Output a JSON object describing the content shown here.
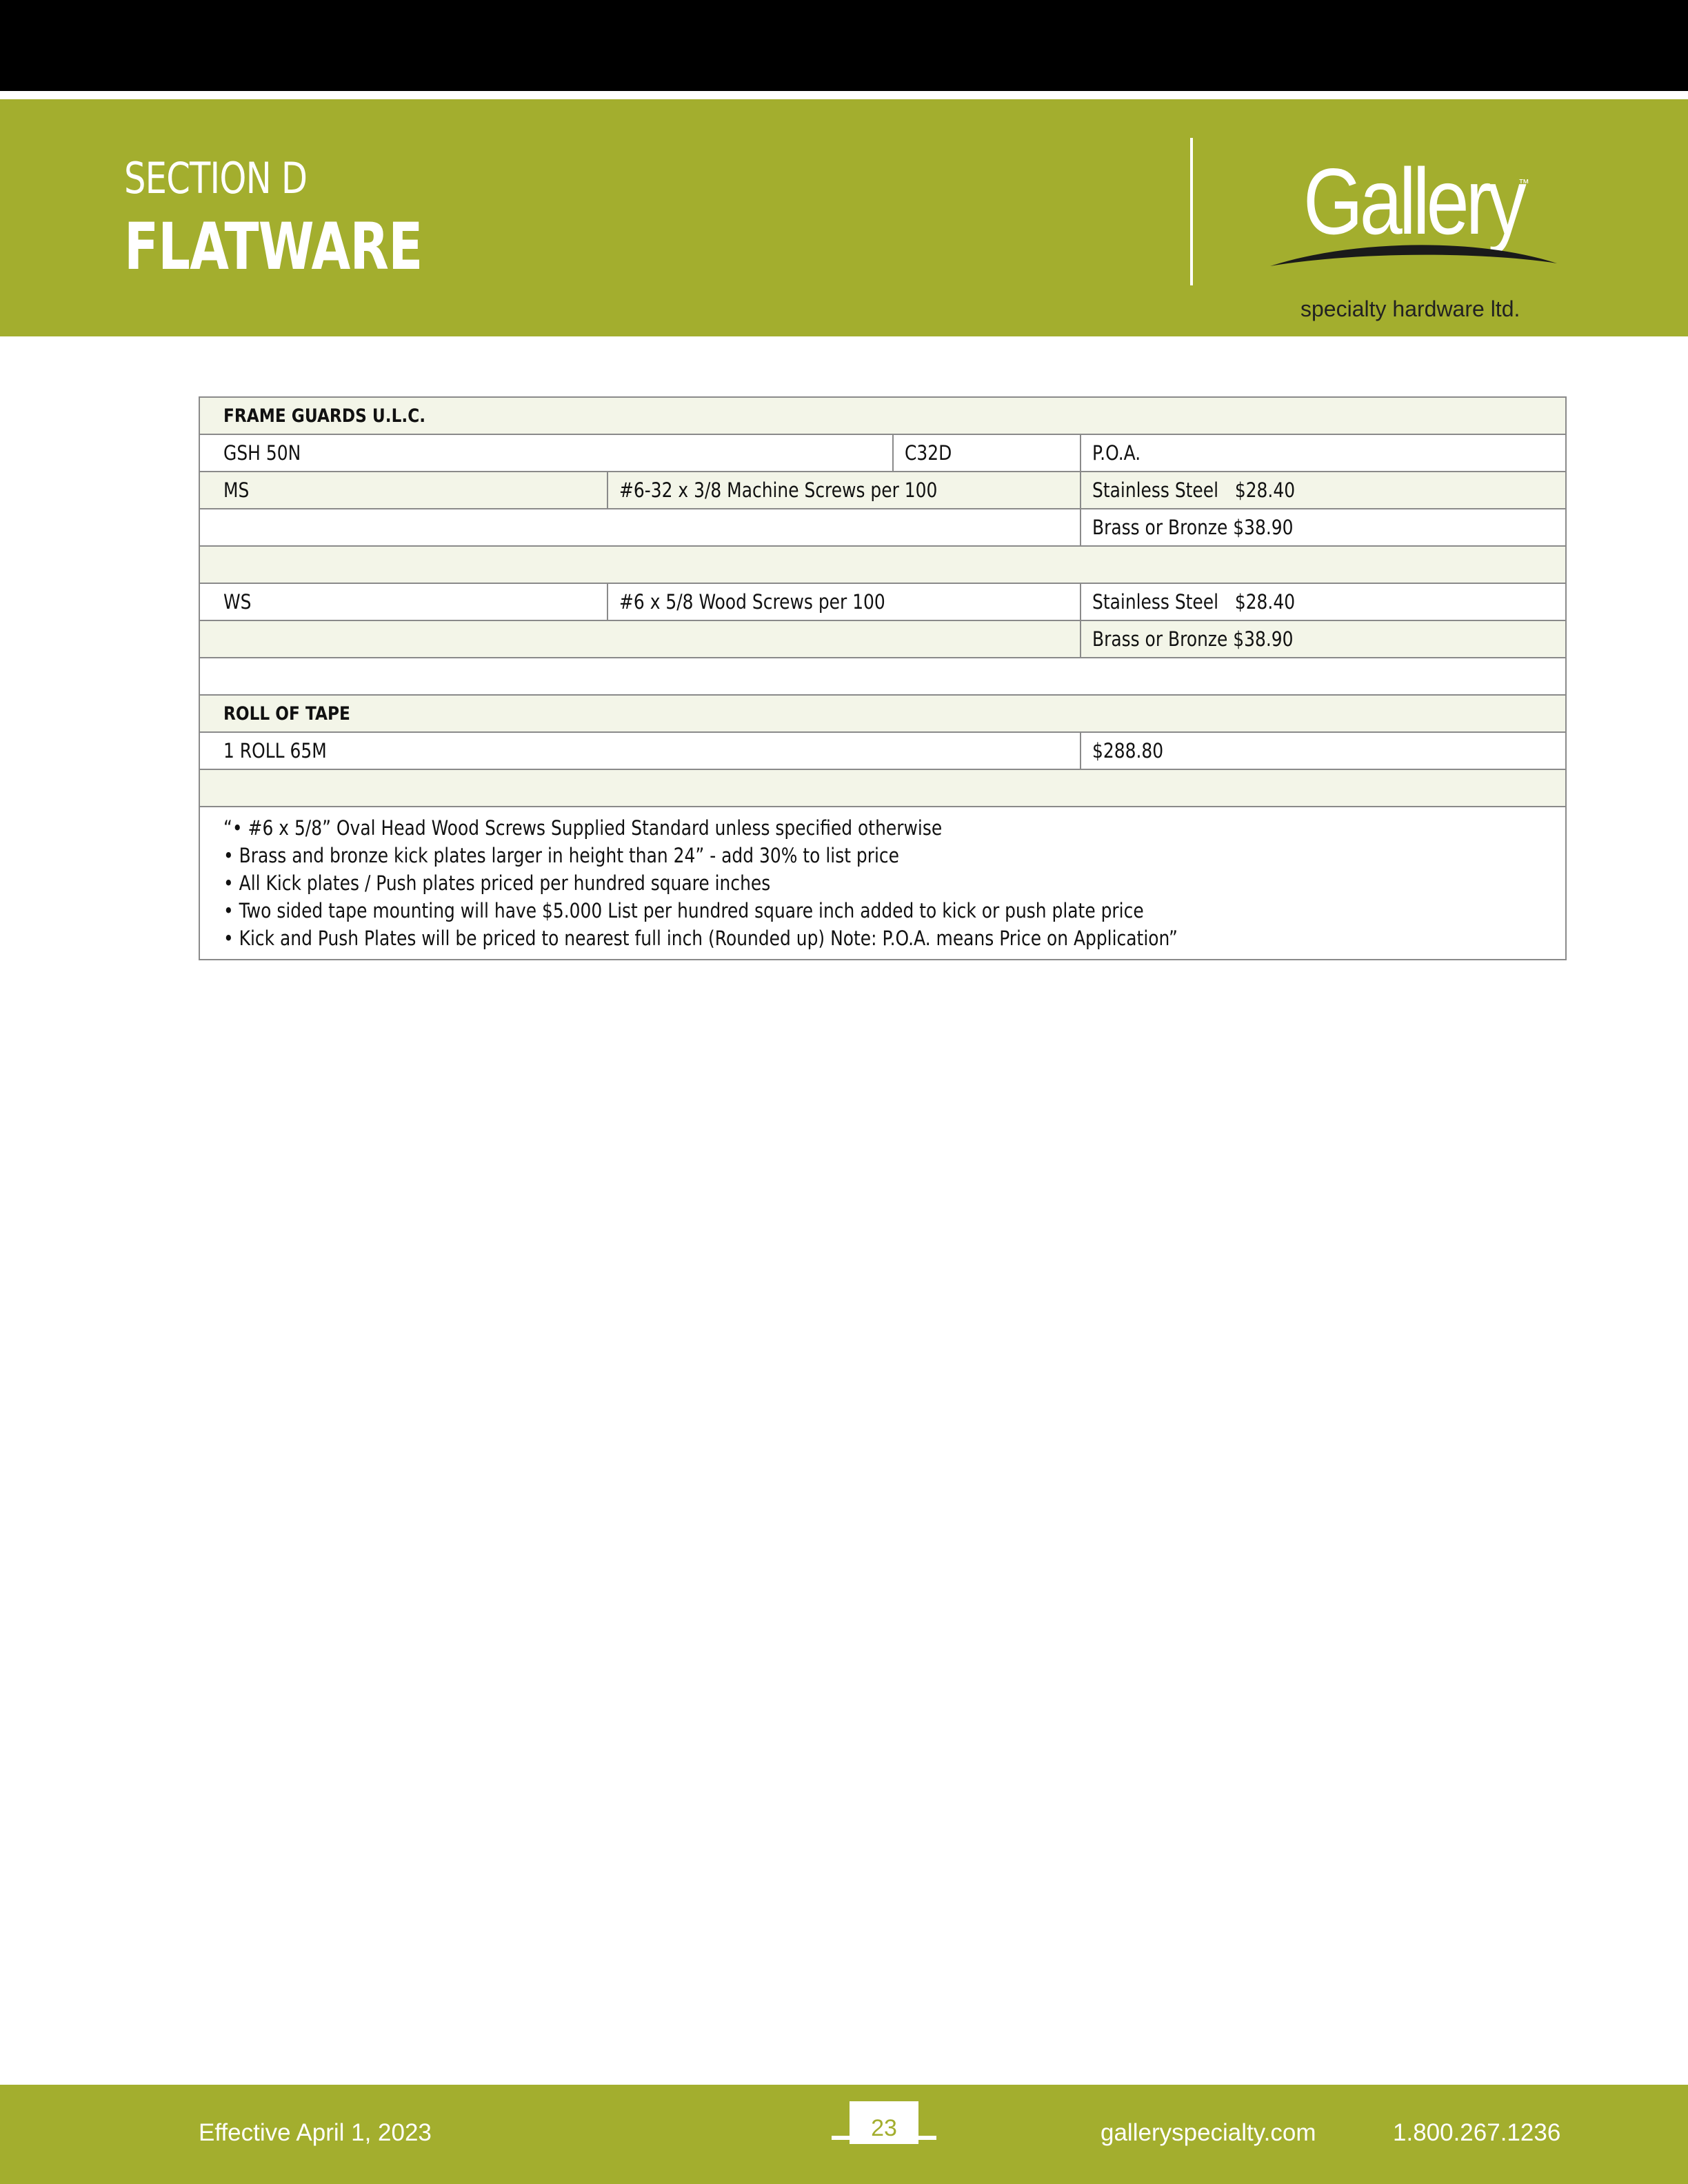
{
  "header": {
    "section_label": "SECTION D",
    "section_title": "FLATWARE",
    "logo": {
      "word": "Gallery",
      "trademark": "™",
      "tagline": "specialty hardware ltd."
    }
  },
  "colors": {
    "brand_green": "#a3ae2e",
    "top_bar": "#000000",
    "row_shade": "#f3f5e8"
  },
  "table": {
    "frame_guards": {
      "heading": "FRAME GUARDS U.L.C.",
      "row1": {
        "model": "GSH 50N",
        "finish": "C32D",
        "price": "P.O.A."
      },
      "ms": {
        "code": "MS",
        "desc": "#6-32 x 3/8 Machine Screws per 100",
        "ss": "Stainless Steel   $28.40",
        "brass": "Brass or Bronze $38.90"
      },
      "ws": {
        "code": "WS",
        "desc": "#6 x 5/8 Wood Screws per 100",
        "ss": "Stainless Steel   $28.40",
        "brass": "Brass or Bronze $38.90"
      }
    },
    "roll_of_tape": {
      "heading": "ROLL OF TAPE",
      "item": "1 ROLL 65M",
      "price": "$288.80"
    },
    "notes": [
      "“• #6 x 5/8” Oval Head Wood Screws Supplied Standard unless specified otherwise",
      "• Brass and bronze kick plates larger in height than 24”  - add 30% to list price",
      "• All Kick plates / Push plates priced per hundred square inches",
      "• Two sided tape mounting will have $5.000 List per hundred square inch added to kick or push plate price",
      "• Kick and Push Plates will be priced to nearest full inch (Rounded up) Note: P.O.A. means Price on Application”"
    ]
  },
  "footer": {
    "effective": "Effective April 1, 2023",
    "page_number": "23",
    "website": "galleryspecialty.com",
    "phone": "1.800.267.1236"
  }
}
